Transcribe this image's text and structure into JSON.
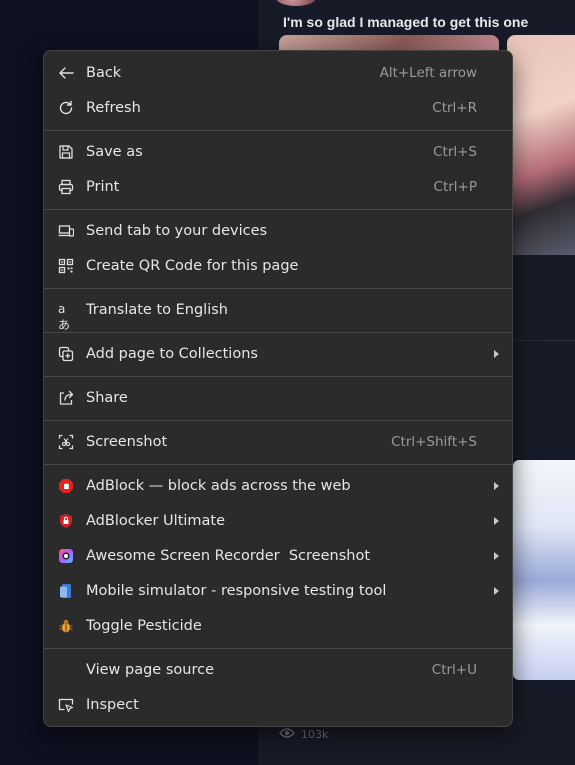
{
  "page": {
    "post_title": "I'm so glad I managed to get this one",
    "view_count": "103k"
  },
  "menu": {
    "back": {
      "label": "Back",
      "shortcut": "Alt+Left arrow"
    },
    "refresh": {
      "label": "Refresh",
      "shortcut": "Ctrl+R"
    },
    "save_as": {
      "label": "Save as",
      "shortcut": "Ctrl+S"
    },
    "print": {
      "label": "Print",
      "shortcut": "Ctrl+P"
    },
    "send_tab": {
      "label": "Send tab to your devices"
    },
    "qr_code": {
      "label": "Create QR Code for this page"
    },
    "translate": {
      "label": "Translate to English"
    },
    "collections": {
      "label": "Add page to Collections"
    },
    "share": {
      "label": "Share"
    },
    "screenshot": {
      "label": "Screenshot",
      "shortcut": "Ctrl+Shift+S"
    },
    "adblock": {
      "label": "AdBlock — block ads across the web"
    },
    "adblocker_ultimate": {
      "label": "AdBlocker Ultimate"
    },
    "screen_recorder": {
      "label": "Awesome Screen Recorder  Screenshot"
    },
    "mobile_simulator": {
      "label": "Mobile simulator - responsive testing tool"
    },
    "pesticide": {
      "label": "Toggle Pesticide"
    },
    "view_source": {
      "label": "View page source",
      "shortcut": "Ctrl+U"
    },
    "inspect": {
      "label": "Inspect"
    }
  },
  "icons": {
    "back": "arrow-left-icon",
    "refresh": "refresh-icon",
    "save_as": "save-as-icon",
    "print": "printer-icon",
    "send_tab": "devices-icon",
    "qr_code": "qr-code-icon",
    "translate": "translate-icon",
    "collections": "collections-icon",
    "share": "share-icon",
    "screenshot": "screenshot-icon",
    "adblock": "adblock-icon",
    "adblocker_ultimate": "adblocker-ultimate-icon",
    "screen_recorder": "screen-recorder-icon",
    "mobile_simulator": "mobile-simulator-icon",
    "pesticide": "pesticide-icon",
    "inspect": "inspect-icon"
  },
  "colors": {
    "menu_bg": "#2b2b2b",
    "text": "#e6e6e6",
    "shortcut": "#9a9a9a",
    "adblock_red": "#e2231a",
    "adblocker_ultimate_red": "#d31f26",
    "mobile_simulator_blue": "#3a7bd5",
    "pesticide_orange": "#e8a23a"
  }
}
